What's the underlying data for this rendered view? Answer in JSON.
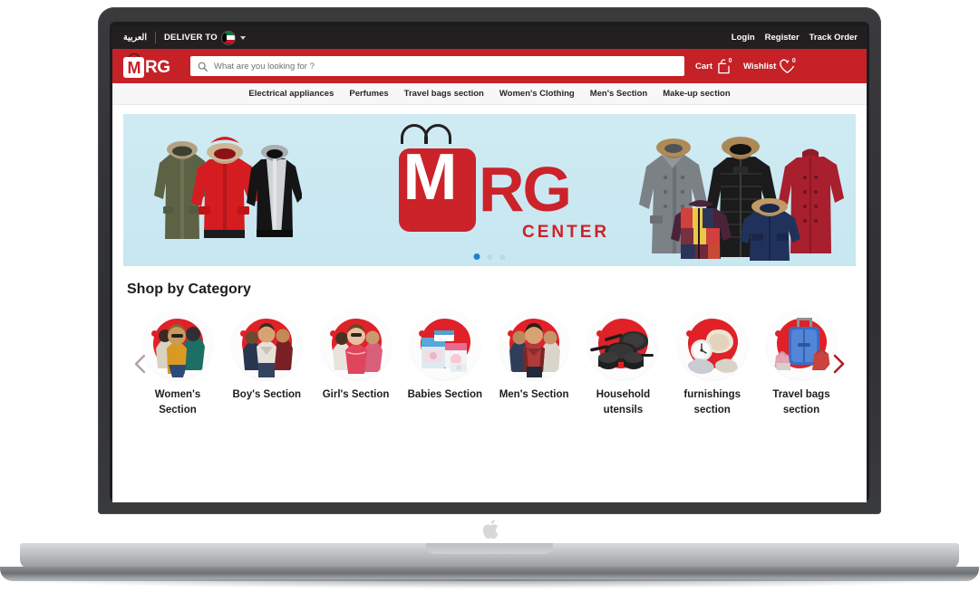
{
  "topbar": {
    "language_label": "العربية",
    "deliver_to_label": "DELIVER TO",
    "flag_icon": "kuwait-flag-icon",
    "caret_icon": "chevron-down-icon",
    "links": [
      {
        "label": "Login"
      },
      {
        "label": "Register"
      },
      {
        "label": "Track Order"
      }
    ]
  },
  "header": {
    "brand": {
      "mark": "M",
      "rest": "RG"
    },
    "search": {
      "placeholder": "What are you looking for ?",
      "value": "",
      "icon": "search-icon"
    },
    "cart": {
      "label": "Cart",
      "count": "0",
      "icon": "shopping-bag-icon"
    },
    "wishlist": {
      "label": "Wishlist",
      "count": "0",
      "icon": "heart-icon"
    }
  },
  "nav": {
    "items": [
      {
        "label": "Electrical appliances"
      },
      {
        "label": "Perfumes"
      },
      {
        "label": "Travel bags section"
      },
      {
        "label": "Women's Clothing"
      },
      {
        "label": "Men's Section"
      },
      {
        "label": "Make-up section"
      }
    ]
  },
  "hero": {
    "logo": {
      "mark": "M",
      "rest": "RG",
      "subtitle": "CENTER"
    },
    "background_color": "#c9e8f1",
    "brand_red": "#cc2229",
    "slides": [
      {
        "active": true
      },
      {
        "active": false
      },
      {
        "active": false
      }
    ]
  },
  "categories": {
    "title": "Shop by Category",
    "prev_icon": "chevron-left-icon",
    "next_icon": "chevron-right-icon",
    "items": [
      {
        "label": "Women's Section",
        "art": "women-clothing-art"
      },
      {
        "label": "Boy's Section",
        "art": "boys-clothing-art"
      },
      {
        "label": "Girl's Section",
        "art": "girls-clothing-art"
      },
      {
        "label": "Babies Section",
        "art": "babies-products-art"
      },
      {
        "label": "Men's Section",
        "art": "mens-clothing-art"
      },
      {
        "label": "Household utensils",
        "art": "cookware-art"
      },
      {
        "label": "furnishings section",
        "art": "home-furnishing-art"
      },
      {
        "label": "Travel bags section",
        "art": "luggage-art"
      }
    ]
  },
  "device": {
    "logo_icon": "apple-logo-icon"
  }
}
